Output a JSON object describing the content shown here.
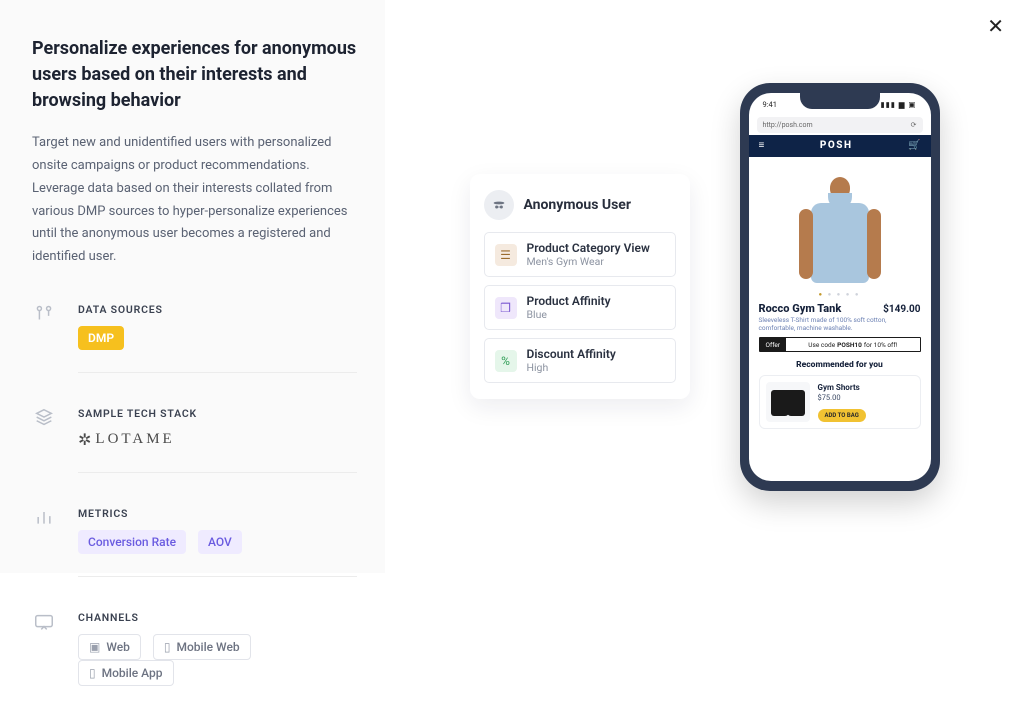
{
  "left_panel": {
    "heading": "Personalize experiences for anonymous users based on their interests and browsing behavior",
    "description": "Target new and unidentified users with personalized onsite campaigns or product recommendations. Leverage data based on their interests collated from various DMP sources to hyper-personalize experiences until the anonymous user becomes a registered and identified user.",
    "sections": {
      "data_sources": {
        "label": "DATA SOURCES",
        "items": [
          "DMP"
        ]
      },
      "tech_stack": {
        "label": "SAMPLE TECH STACK",
        "logo_text": "LOTAME"
      },
      "metrics": {
        "label": "METRICS",
        "items": [
          "Conversion Rate",
          "AOV"
        ]
      },
      "channels": {
        "label": "CHANNELS",
        "items": [
          "Web",
          "Mobile Web",
          "Mobile App"
        ]
      }
    }
  },
  "user_card": {
    "title": "Anonymous User",
    "attributes": [
      {
        "title": "Product Category View",
        "subtitle": "Men's Gym Wear"
      },
      {
        "title": "Product Affinity",
        "subtitle": "Blue"
      },
      {
        "title": "Discount Affinity",
        "subtitle": "High"
      }
    ]
  },
  "phone": {
    "status_time": "9:41",
    "url": "http://posh.com",
    "brand": "POSH",
    "product": {
      "name": "Rocco Gym Tank",
      "price": "$149.00",
      "subtitle": "Sleeveless T-Shirt made of 100% soft cotton, comfortable, machine washable."
    },
    "offer": {
      "label": "Offer",
      "prefix": "Use code ",
      "code": "POSH10",
      "suffix": " for 10% off!"
    },
    "recommended_title": "Recommended for you",
    "recommended": {
      "name": "Gym Shorts",
      "price": "$75.00",
      "cta": "ADD TO BAG"
    }
  }
}
